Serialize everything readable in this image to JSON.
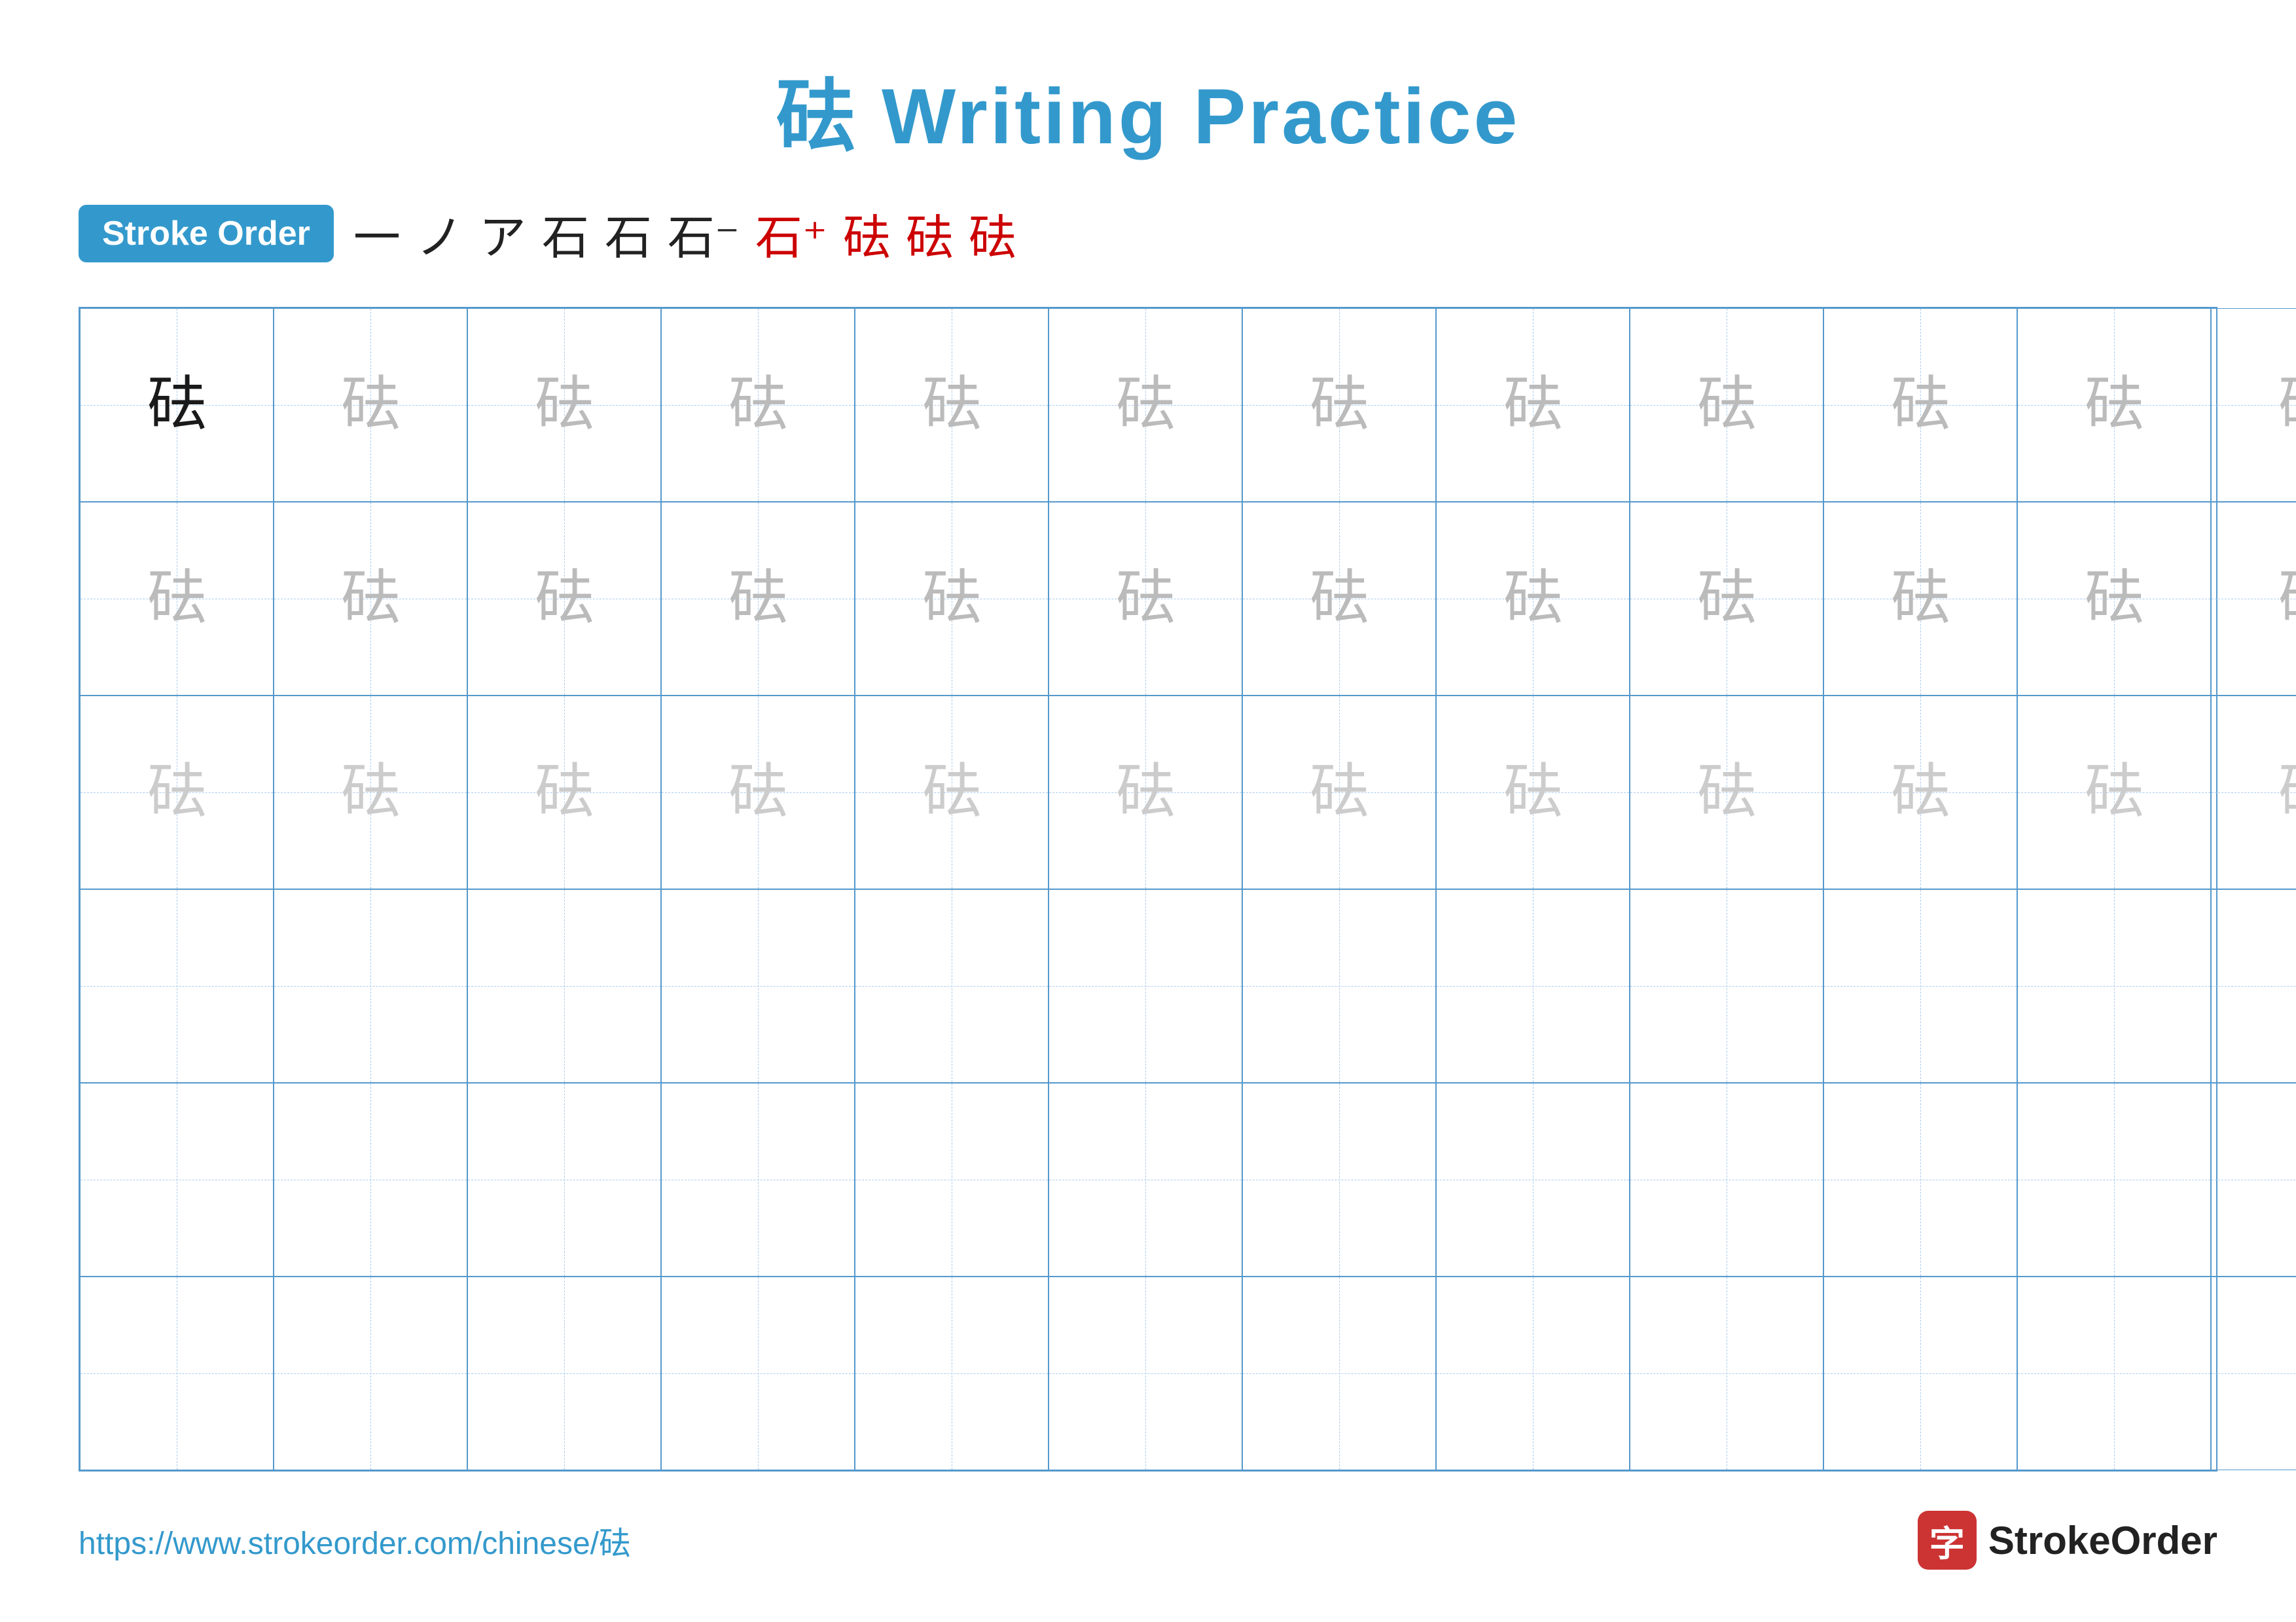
{
  "title": "砝 Writing Practice",
  "stroke_order": {
    "badge_label": "Stroke Order",
    "strokes": [
      "一",
      "ノ",
      "ア",
      "石",
      "石",
      "石⁻",
      "石⁺",
      "砝",
      "砝",
      "砝"
    ]
  },
  "character": "砝",
  "grid": {
    "cols": 13,
    "rows": 6,
    "row1_shading": [
      "dark",
      "light1",
      "light1",
      "light1",
      "light1",
      "light1",
      "light1",
      "light1",
      "light1",
      "light1",
      "light1",
      "light1",
      "light1"
    ],
    "row2_shading": [
      "light1",
      "light1",
      "light1",
      "light1",
      "light1",
      "light1",
      "light1",
      "light1",
      "light1",
      "light1",
      "light1",
      "light1",
      "light1"
    ],
    "row3_shading": [
      "light2",
      "light2",
      "light2",
      "light2",
      "light2",
      "light2",
      "light2",
      "light2",
      "light2",
      "light2",
      "light2",
      "light2",
      "light2"
    ],
    "row4_shading": [
      "none",
      "none",
      "none",
      "none",
      "none",
      "none",
      "none",
      "none",
      "none",
      "none",
      "none",
      "none",
      "none"
    ],
    "row5_shading": [
      "none",
      "none",
      "none",
      "none",
      "none",
      "none",
      "none",
      "none",
      "none",
      "none",
      "none",
      "none",
      "none"
    ],
    "row6_shading": [
      "none",
      "none",
      "none",
      "none",
      "none",
      "none",
      "none",
      "none",
      "none",
      "none",
      "none",
      "none",
      "none"
    ]
  },
  "footer": {
    "url": "https://www.strokeorder.com/chinese/砝",
    "logo_text": "StrokeOrder",
    "logo_char": "字"
  }
}
